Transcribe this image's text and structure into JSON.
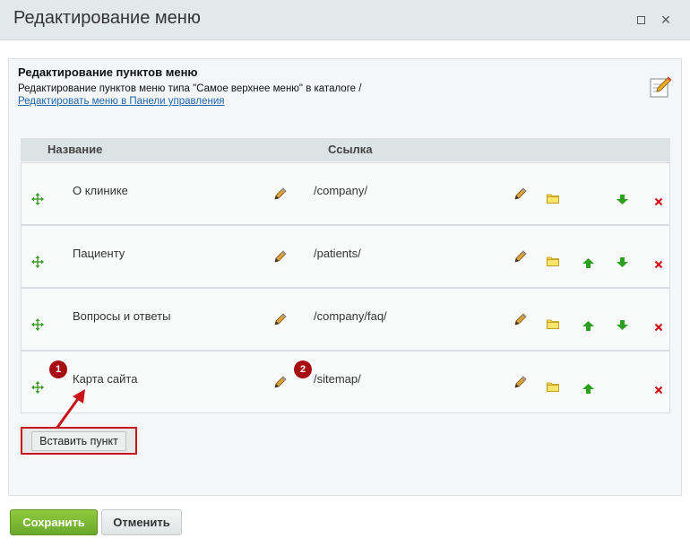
{
  "window": {
    "title": "Редактирование меню"
  },
  "panel": {
    "title": "Редактирование пунктов меню",
    "description": "Редактирование пунктов меню типа \"Самое верхнее меню\" в каталоге /",
    "link": "Редактировать меню в Панели управления"
  },
  "table": {
    "columns": {
      "name": "Название",
      "link": "Ссылка"
    },
    "rows": [
      {
        "name": "О клинике",
        "link": "/company/",
        "has_up": false,
        "has_down": true
      },
      {
        "name": "Пациенту",
        "link": "/patients/",
        "has_up": true,
        "has_down": true
      },
      {
        "name": "Вопросы и ответы",
        "link": "/company/faq/",
        "has_up": true,
        "has_down": true
      },
      {
        "name": "Карта сайта",
        "link": "/sitemap/",
        "has_up": true,
        "has_down": false
      }
    ]
  },
  "annotations": {
    "badge1": "1",
    "badge2": "2",
    "color": "#a50e12"
  },
  "buttons": {
    "insert": "Вставить пункт",
    "save": "Сохранить",
    "cancel": "Отменить"
  },
  "icons": {
    "move": "move-icon",
    "edit": "pencil-icon",
    "folder": "folder-icon",
    "up": "arrow-up-icon",
    "down": "arrow-down-icon",
    "delete": "delete-icon"
  },
  "colors": {
    "accent": "#6aa82a",
    "link": "#2067b0",
    "delete": "#d0141a",
    "arrow": "#2e9e1f",
    "folder": "#f2d33a"
  }
}
